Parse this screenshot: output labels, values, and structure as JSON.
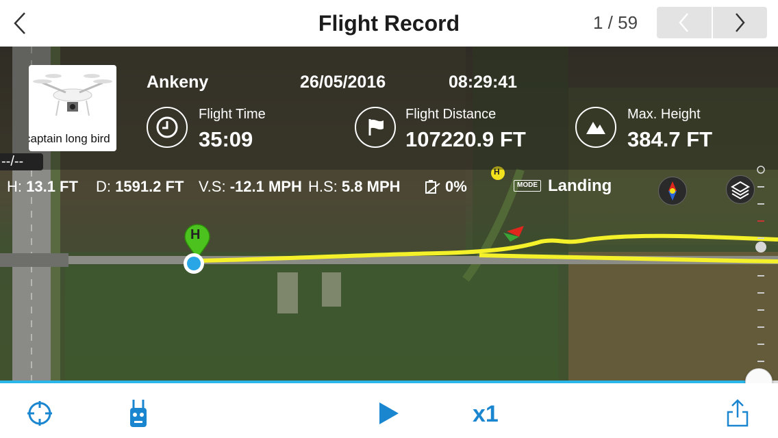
{
  "header": {
    "title": "Flight Record",
    "pager": "1 / 59",
    "back_icon": "chevron-left-icon",
    "prev_icon": "chevron-left-icon",
    "next_icon": "chevron-right-icon"
  },
  "flight": {
    "aircraft_name": "captain long bird",
    "location": "Ankeny",
    "date": "26/05/2016",
    "time": "08:29:41",
    "altitude_badge": "--/--"
  },
  "stats": [
    {
      "label": "Flight Time",
      "value": "35:09",
      "icon": "clock-icon"
    },
    {
      "label": "Flight Distance",
      "value": "107220.9 FT",
      "icon": "flag-icon"
    },
    {
      "label": "Max. Height",
      "value": "384.7 FT",
      "icon": "mountain-icon"
    }
  ],
  "telemetry": {
    "h_label": "H:",
    "h_value": "13.1 FT",
    "d_label": "D:",
    "d_value": "1591.2 FT",
    "vs_label": "V.S:",
    "vs_value": "-12.1 MPH",
    "hs_label": "H.S:",
    "hs_value": "5.8 MPH",
    "battery_value": "0%",
    "mode_badge": "MODE",
    "mode_value": "Landing"
  },
  "map": {
    "home_marker": "H",
    "home_point_small": "H",
    "route_color": "#f4f12a",
    "aircraft_color": "#e0271e"
  },
  "playback": {
    "progress": 0.975,
    "speed": "x1",
    "accent": "#1a86d0",
    "progress_color": "#2bb6ea"
  }
}
